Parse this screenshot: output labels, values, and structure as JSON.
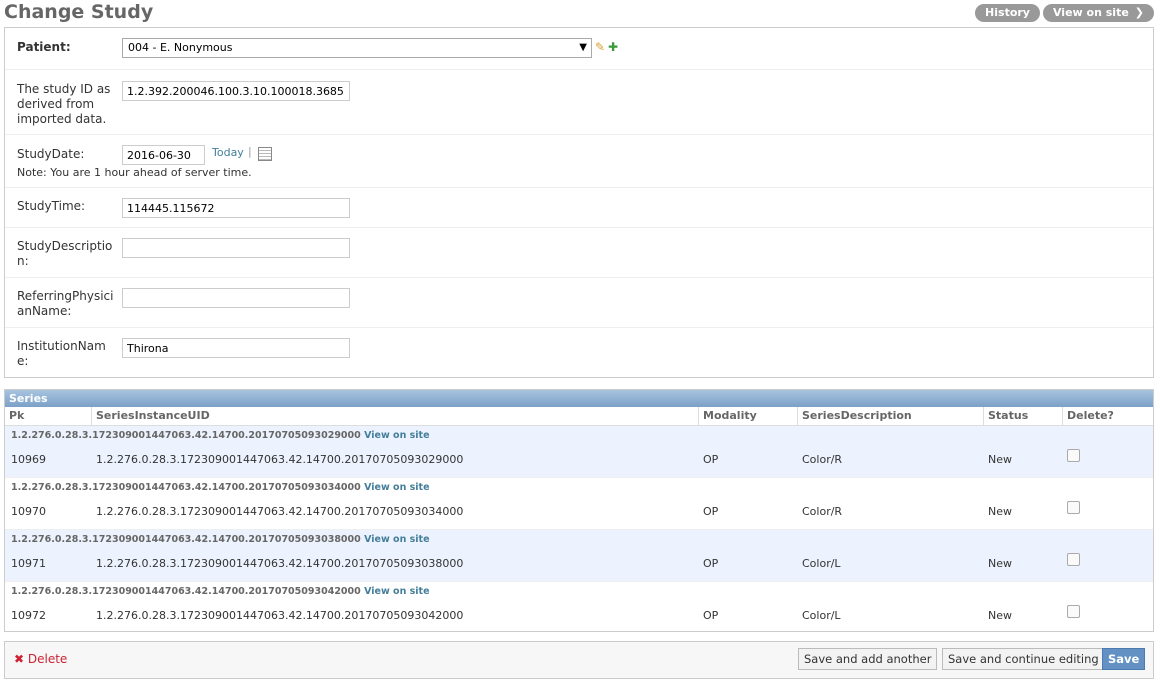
{
  "page": {
    "title": "Change Study",
    "history_label": "History",
    "view_on_site_label": "View on site",
    "view_on_site_arrow": "❯"
  },
  "form": {
    "patient": {
      "label": "Patient:",
      "value": "004 - E. Nonymous"
    },
    "study_id": {
      "label": "The study ID as derived from imported data.",
      "value": "1.2.392.200046.100.3.10.100018.3685"
    },
    "study_date": {
      "label": "StudyDate:",
      "value": "2016-06-30",
      "today_label": "Today",
      "separator": "|",
      "note": "Note: You are 1 hour ahead of server time."
    },
    "study_time": {
      "label": "StudyTime:",
      "value": "114445.115672"
    },
    "study_description": {
      "label": "StudyDescription:",
      "value": ""
    },
    "referring_physician": {
      "label": "ReferringPhysicianName:",
      "value": ""
    },
    "institution": {
      "label": "InstitutionName:",
      "value": "Thirona"
    }
  },
  "series": {
    "caption": "Series",
    "columns": [
      "Pk",
      "SeriesInstanceUID",
      "Modality",
      "SeriesDescription",
      "Status",
      "Delete?"
    ],
    "view_on_site_label": "View on site",
    "rows": [
      {
        "uid_title": "1.2.276.0.28.3.172309001447063.42.14700.20170705093029000",
        "pk": "10969",
        "uid": "1.2.276.0.28.3.172309001447063.42.14700.20170705093029000",
        "modality": "OP",
        "description": "Color/R",
        "status": "New"
      },
      {
        "uid_title": "1.2.276.0.28.3.172309001447063.42.14700.20170705093034000",
        "pk": "10970",
        "uid": "1.2.276.0.28.3.172309001447063.42.14700.20170705093034000",
        "modality": "OP",
        "description": "Color/R",
        "status": "New"
      },
      {
        "uid_title": "1.2.276.0.28.3.172309001447063.42.14700.20170705093038000",
        "pk": "10971",
        "uid": "1.2.276.0.28.3.172309001447063.42.14700.20170705093038000",
        "modality": "OP",
        "description": "Color/L",
        "status": "New"
      },
      {
        "uid_title": "1.2.276.0.28.3.172309001447063.42.14700.20170705093042000",
        "pk": "10972",
        "uid": "1.2.276.0.28.3.172309001447063.42.14700.20170705093042000",
        "modality": "OP",
        "description": "Color/L",
        "status": "New"
      }
    ]
  },
  "submit": {
    "delete_label": "Delete",
    "delete_icon": "✖",
    "save_add_label": "Save and add another",
    "save_continue_label": "Save and continue editing",
    "save_label": "Save"
  },
  "icons": {
    "edit": "✎",
    "add": "✚",
    "caret": "▼",
    "calendar": "calendar-icon"
  },
  "colors": {
    "link": "#447e9b",
    "delete": "#cc2233",
    "header_bar": "#7ca0c7",
    "alt_row": "#edf3fe",
    "save_button": "#6391c4"
  }
}
